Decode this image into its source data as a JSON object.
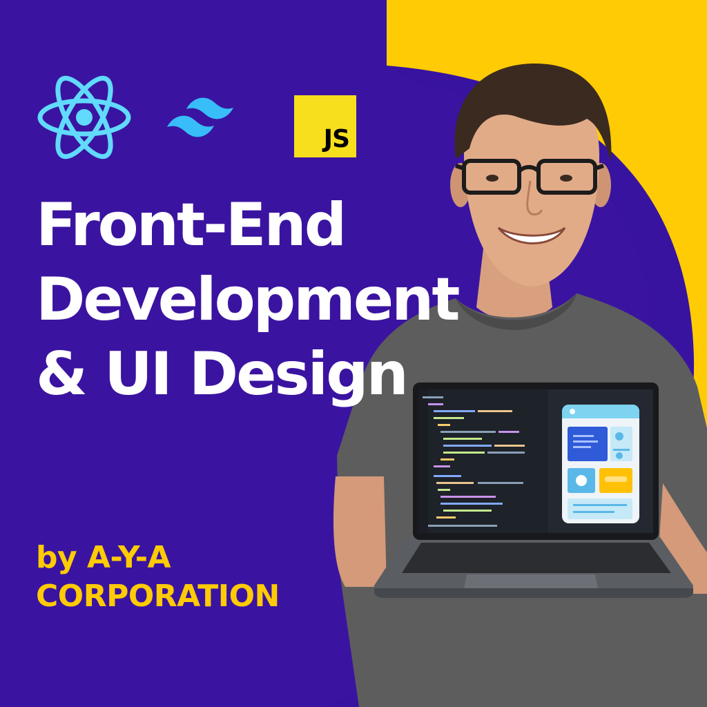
{
  "logos": {
    "react": {
      "icon": "react-atom-icon",
      "color": "#61dafb"
    },
    "tailwind": {
      "icon": "tailwind-wave-icon",
      "color": "#38bdf8"
    },
    "javascript": {
      "label": "JS",
      "bg": "#f7df1e"
    }
  },
  "headline": {
    "line1": "Front-End",
    "line2": "Development",
    "line3": "& UI Design"
  },
  "byline": {
    "line1": "by A-Y-A",
    "line2": "CORPORATION"
  },
  "colors": {
    "background": "#3a14a0",
    "accent_yellow": "#ffcb05",
    "headline": "#ffffff"
  },
  "laptop": {
    "app_preview": {
      "header_color": "#7dd3f0",
      "card_blue": "#2f5bd8",
      "card_teal": "#5ab8e8",
      "card_yellow": "#ffc107"
    }
  }
}
